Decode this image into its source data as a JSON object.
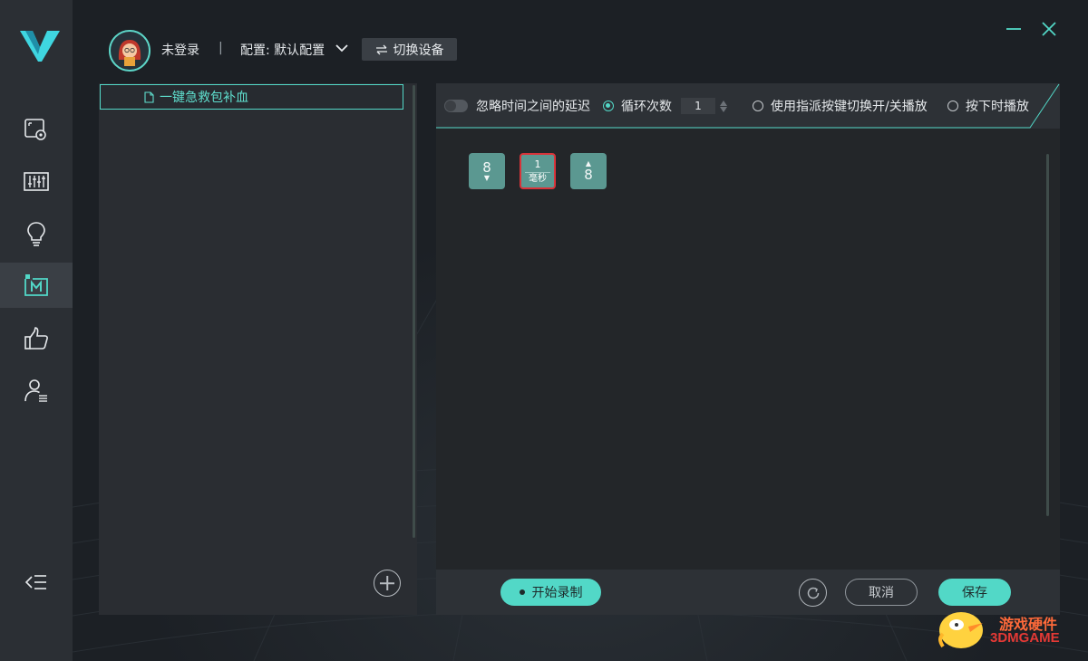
{
  "header": {
    "user_status": "未登录",
    "separator": "|",
    "config_label": "配置: 默认配置",
    "switch_device_label": "切换设备"
  },
  "macro_list": {
    "items": [
      {
        "label": "一键急救包补血"
      }
    ]
  },
  "toolbar": {
    "ignore_delay_label": "忽略时间之间的延迟",
    "loop_count_label": "循环次数",
    "loop_count_value": "1",
    "toggle_key_label": "使用指派按键切换开/关播放",
    "press_play_label": "按下时播放"
  },
  "sequence": {
    "key_down": {
      "key": "8",
      "arrow": "▼"
    },
    "delay": {
      "value": "1",
      "unit": "毫秒"
    },
    "key_up": {
      "key": "8",
      "arrow": "▲"
    }
  },
  "bottom_bar": {
    "record_label": "开始录制",
    "cancel_label": "取消",
    "save_label": "保存"
  },
  "watermark": {
    "line1": "游戏硬件",
    "line2": "3DMGAME"
  },
  "colors": {
    "accent": "#52d8c7",
    "sidebar_bg": "#2b2f34",
    "panel_bg": "#2a2d32",
    "key_block": "#5b9891",
    "delay_border": "#d8343a"
  },
  "icons": {
    "logo": "v-logo",
    "nav": [
      "screen-settings-icon",
      "equalizer-icon",
      "lightbulb-icon",
      "macro-icon",
      "thumbs-up-icon",
      "user-list-icon",
      "collapse-menu-icon"
    ]
  }
}
